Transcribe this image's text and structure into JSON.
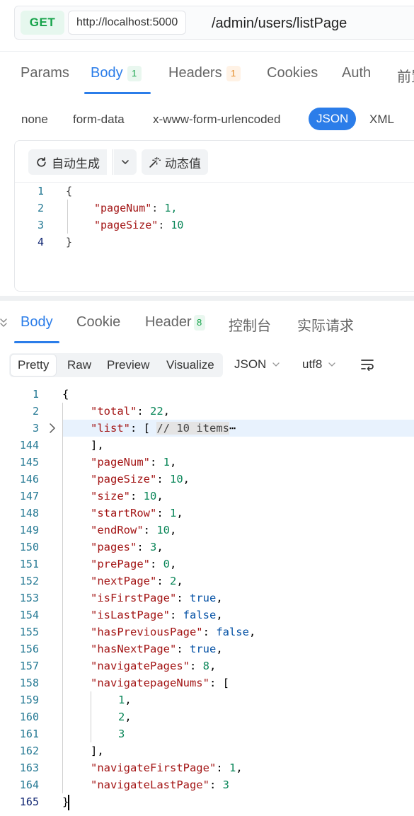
{
  "request": {
    "method": "GET",
    "base_url": "http://localhost:5000",
    "path": "/admin/users/listPage",
    "tabs": [
      {
        "label": "Params"
      },
      {
        "label": "Body",
        "badge": "1"
      },
      {
        "label": "Headers",
        "badge": "1"
      },
      {
        "label": "Cookies"
      },
      {
        "label": "Auth"
      },
      {
        "label": "前置"
      }
    ],
    "body_types": [
      "none",
      "form-data",
      "x-www-form-urlencoded",
      "JSON",
      "XML"
    ],
    "active_body_type": "JSON",
    "toolbar": {
      "auto_generate": "自动生成",
      "dynamic_value": "动态值"
    },
    "code_lines": [
      {
        "num": "1",
        "text": "{"
      },
      {
        "num": "2",
        "key": "\"pageNum\"",
        "value": "1,"
      },
      {
        "num": "3",
        "key": "\"pageSize\"",
        "value": "10"
      },
      {
        "num": "4",
        "text": "}"
      }
    ]
  },
  "response": {
    "tabs": [
      {
        "label": "Body"
      },
      {
        "label": "Cookie"
      },
      {
        "label": "Header",
        "badge": "8"
      },
      {
        "label": "控制台"
      },
      {
        "label": "实际请求"
      }
    ],
    "view_modes": [
      "Pretty",
      "Raw",
      "Preview",
      "Visualize"
    ],
    "active_view": "Pretty",
    "format": "JSON",
    "encoding": "utf8",
    "line_numbers": [
      "1",
      "2",
      "3",
      "144",
      "145",
      "146",
      "147",
      "148",
      "149",
      "150",
      "151",
      "152",
      "153",
      "154",
      "155",
      "156",
      "157",
      "158",
      "159",
      "160",
      "161",
      "162",
      "163",
      "164",
      "165"
    ],
    "fields": {
      "total": {
        "key": "\"total\"",
        "value": "22"
      },
      "list": {
        "key": "\"list\"",
        "comment": "// 10 items",
        "ellipsis": "⋯"
      },
      "pageNum": {
        "key": "\"pageNum\"",
        "value": "1"
      },
      "pageSize": {
        "key": "\"pageSize\"",
        "value": "10"
      },
      "size": {
        "key": "\"size\"",
        "value": "10"
      },
      "startRow": {
        "key": "\"startRow\"",
        "value": "1"
      },
      "endRow": {
        "key": "\"endRow\"",
        "value": "10"
      },
      "pages": {
        "key": "\"pages\"",
        "value": "3"
      },
      "prePage": {
        "key": "\"prePage\"",
        "value": "0"
      },
      "nextPage": {
        "key": "\"nextPage\"",
        "value": "2"
      },
      "isFirstPage": {
        "key": "\"isFirstPage\"",
        "value": "true"
      },
      "isLastPage": {
        "key": "\"isLastPage\"",
        "value": "false"
      },
      "hasPreviousPage": {
        "key": "\"hasPreviousPage\"",
        "value": "false"
      },
      "hasNextPage": {
        "key": "\"hasNextPage\"",
        "value": "true"
      },
      "navigatePages": {
        "key": "\"navigatePages\"",
        "value": "8"
      },
      "navigatepageNums": {
        "key": "\"navigatepageNums\"",
        "values": [
          "1",
          "2",
          "3"
        ]
      },
      "navigateFirstPage": {
        "key": "\"navigateFirstPage\"",
        "value": "1"
      },
      "navigateLastPage": {
        "key": "\"navigateLastPage\"",
        "value": "3"
      }
    }
  },
  "colors": {
    "accent": "#2b7de9",
    "method_green": "#16a34a",
    "badge_orange": "#e38a25",
    "json_key": "#a31515",
    "json_number": "#098658",
    "json_boolean": "#0451a5",
    "line_number": "#237893"
  }
}
